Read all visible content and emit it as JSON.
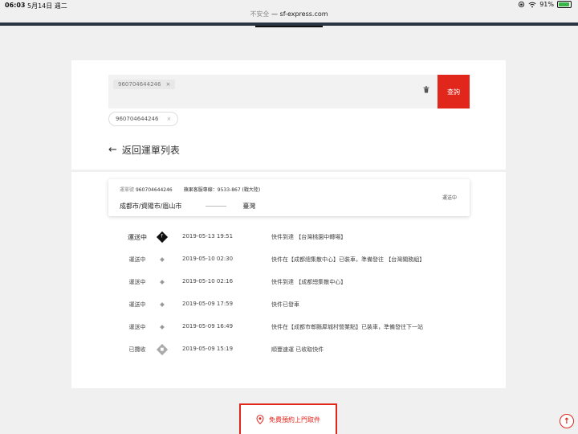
{
  "status_bar": {
    "time": "06:03",
    "date": "5月14日 週二",
    "battery": "91%",
    "battery_level": 0.91
  },
  "url_bar": {
    "insecure": "不安全",
    "separator": "—",
    "domain": "sf-express.com"
  },
  "search": {
    "tag_value": "960704644246",
    "button_label": "查詢",
    "history_chip": "960704644246"
  },
  "back_link": "返回運單列表",
  "waybill": {
    "number_label": "運單號",
    "number": "960704644246",
    "hotline_label": "蘋果客服專線：",
    "hotline": "9533-867 (戰大陸)",
    "origin": "成都市/資陽市/眉山市",
    "destination": "臺灣",
    "status": "運送中"
  },
  "timeline": [
    {
      "status": "運送中",
      "time": "2019-05-13 19:51",
      "desc": "快件到達 【台灣桃園中轉場】"
    },
    {
      "status": "運送中",
      "time": "2019-05-10 02:30",
      "desc": "快件在【成都總集散中心】已裝車，準備發往 【台灣關務組】"
    },
    {
      "status": "運送中",
      "time": "2019-05-10 02:16",
      "desc": "快件到達 【成都總集散中心】"
    },
    {
      "status": "運送中",
      "time": "2019-05-09 17:59",
      "desc": "快件已發車"
    },
    {
      "status": "運送中",
      "time": "2019-05-09 16:49",
      "desc": "快件在【成都市郫縣犀城村營業點】已裝車，準備發往下一站"
    },
    {
      "status": "已攬收",
      "time": "2019-05-09 15:19",
      "desc": "順豐速運 已收取快件"
    }
  ],
  "pickup_button": "免費預約上門取件",
  "colors": {
    "brand_red": "#e1261c"
  }
}
